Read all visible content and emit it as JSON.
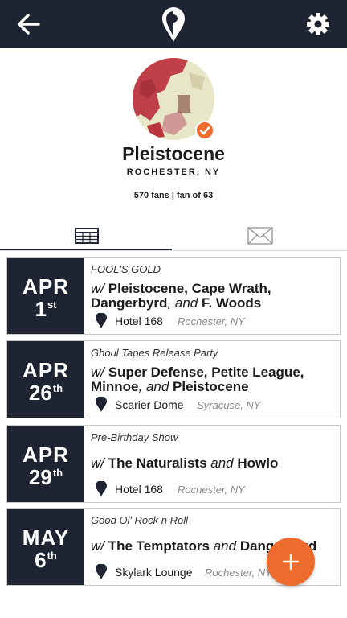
{
  "header": {
    "back_icon": "arrow-left-icon",
    "logo_icon": "map-pin-logo-icon",
    "settings_icon": "gear-icon",
    "background": "#1e2431"
  },
  "profile": {
    "name": "Pleistocene",
    "location": "ROCHESTER, NY",
    "stats": "570 fans | fan of 63",
    "verified": true,
    "verified_icon": "check-icon",
    "accent": "#ee6b2e"
  },
  "tabs": [
    {
      "name": "shows",
      "icon": "table-icon",
      "active": true
    },
    {
      "name": "messages",
      "icon": "envelope-icon",
      "active": false
    }
  ],
  "events": [
    {
      "month": "APR",
      "day": "1",
      "suffix": "st",
      "title": "FOOL'S GOLD",
      "w": "w/",
      "lineup": [
        {
          "text": "Pleistocene",
          "style": "b"
        },
        {
          "text": ", ",
          "style": "b"
        },
        {
          "text": "Cape Wrath",
          "style": "b"
        },
        {
          "text": ", ",
          "style": "b"
        },
        {
          "text": "Dangerbyrd",
          "style": "b"
        },
        {
          "text": ", and ",
          "style": "i"
        },
        {
          "text": "F. Woods",
          "style": "b"
        }
      ],
      "venue": "Hotel 168",
      "city": "Rochester, NY"
    },
    {
      "month": "APR",
      "day": "26",
      "suffix": "th",
      "title": "Ghoul Tapes Release Party",
      "w": "w/",
      "lineup": [
        {
          "text": "Super Defense",
          "style": "b"
        },
        {
          "text": ", ",
          "style": "b"
        },
        {
          "text": "Petite League",
          "style": "b"
        },
        {
          "text": ", ",
          "style": "b"
        },
        {
          "text": "Minnoe",
          "style": "b"
        },
        {
          "text": ", and ",
          "style": "i"
        },
        {
          "text": "Pleistocene",
          "style": "b"
        }
      ],
      "venue": "Scarier Dome",
      "city": "Syracuse, NY"
    },
    {
      "month": "APR",
      "day": "29",
      "suffix": "th",
      "title": "Pre-Birthday Show",
      "w": "w/",
      "lineup": [
        {
          "text": "The Naturalists",
          "style": "b"
        },
        {
          "text": " and ",
          "style": "i"
        },
        {
          "text": "Howlo",
          "style": "b"
        }
      ],
      "venue": "Hotel 168",
      "city": "Rochester, NY"
    },
    {
      "month": "MAY",
      "day": "6",
      "suffix": "th",
      "title": "Good Ol' Rock n Roll",
      "w": "w/",
      "lineup": [
        {
          "text": "The Temptators",
          "style": "b"
        },
        {
          "text": " and ",
          "style": "i"
        },
        {
          "text": "Dangerbyrd",
          "style": "b"
        }
      ],
      "venue": "Skylark Lounge",
      "city": "Rochester, NY"
    }
  ],
  "fab": {
    "icon": "plus-icon",
    "color": "#ee6b2e"
  }
}
